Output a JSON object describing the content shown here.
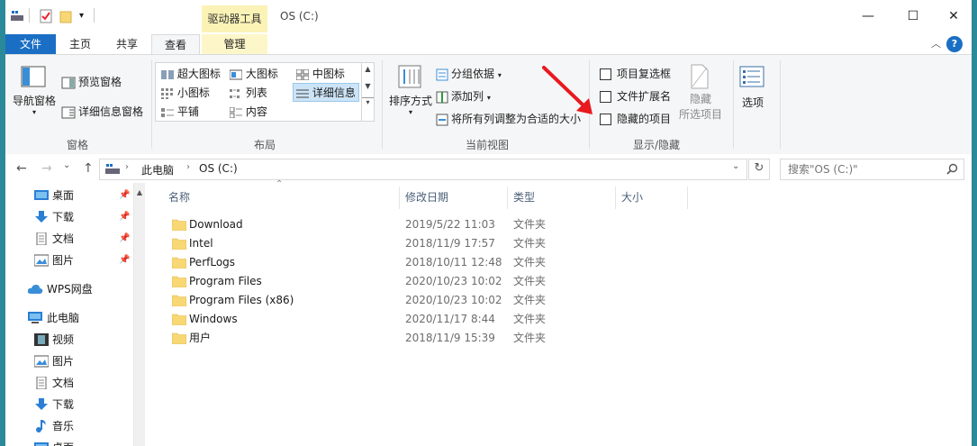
{
  "titlebar": {
    "drive_tools_tab": "驱动器工具",
    "window_title": "OS (C:)",
    "minimize": "—",
    "maximize": "☐",
    "close": "✕"
  },
  "tabs": {
    "file": "文件",
    "home": "主页",
    "share": "共享",
    "view": "查看",
    "manage": "管理",
    "help": "?",
    "collapse": "︿"
  },
  "ribbon": {
    "pane": {
      "nav_pane": "导航窗格",
      "preview_pane": "预览窗格",
      "details_pane": "详细信息窗格",
      "label": "窗格"
    },
    "layout": {
      "items": [
        "超大图标",
        "大图标",
        "中图标",
        "小图标",
        "列表",
        "详细信息",
        "平铺",
        "内容"
      ],
      "label": "布局"
    },
    "current_view": {
      "sort_by": "排序方式",
      "group_by": "分组依据",
      "add_column": "添加列",
      "fit_columns": "将所有列调整为合适的大小",
      "label": "当前视图"
    },
    "show_hide": {
      "item_checkbox": "项目复选框",
      "file_ext": "文件扩展名",
      "hidden_items": "隐藏的项目",
      "hide_selected_line1": "隐藏",
      "hide_selected_line2": "所选项目",
      "label": "显示/隐藏"
    },
    "options": "选项"
  },
  "address": {
    "back": "←",
    "forward": "→",
    "recent": "⌄",
    "up": "↑",
    "crumbs": [
      "此电脑",
      "OS (C:)"
    ],
    "separator": "›",
    "refresh": "↻",
    "search_placeholder": "搜索\"OS (C:)\""
  },
  "nav": {
    "quick_access": [
      {
        "label": "桌面",
        "icon": "desktop-icon"
      },
      {
        "label": "下载",
        "icon": "download-icon"
      },
      {
        "label": "文档",
        "icon": "document-icon"
      },
      {
        "label": "图片",
        "icon": "picture-icon"
      }
    ],
    "wps": "WPS网盘",
    "this_pc": "此电脑",
    "pc_items": [
      {
        "label": "视频",
        "icon": "video-icon"
      },
      {
        "label": "图片",
        "icon": "picture-icon"
      },
      {
        "label": "文档",
        "icon": "document-icon"
      },
      {
        "label": "下载",
        "icon": "download-icon"
      },
      {
        "label": "音乐",
        "icon": "music-icon"
      },
      {
        "label": "桌面",
        "icon": "desktop-icon"
      }
    ]
  },
  "columns": {
    "name": "名称",
    "modified": "修改日期",
    "type": "类型",
    "size": "大小"
  },
  "files": [
    {
      "name": "Download",
      "date": "2019/5/22 11:03",
      "type": "文件夹"
    },
    {
      "name": "Intel",
      "date": "2018/11/9 17:57",
      "type": "文件夹"
    },
    {
      "name": "PerfLogs",
      "date": "2018/10/11 12:48",
      "type": "文件夹"
    },
    {
      "name": "Program Files",
      "date": "2020/10/23 10:02",
      "type": "文件夹"
    },
    {
      "name": "Program Files (x86)",
      "date": "2020/10/23 10:02",
      "type": "文件夹"
    },
    {
      "name": "Windows",
      "date": "2020/11/17 8:44",
      "type": "文件夹"
    },
    {
      "name": "用户",
      "date": "2018/11/9 15:39",
      "type": "文件夹"
    }
  ],
  "colors": {
    "accent": "#1a6fc4",
    "annotation_arrow": "#e8191f",
    "folder": "#f8d775"
  }
}
